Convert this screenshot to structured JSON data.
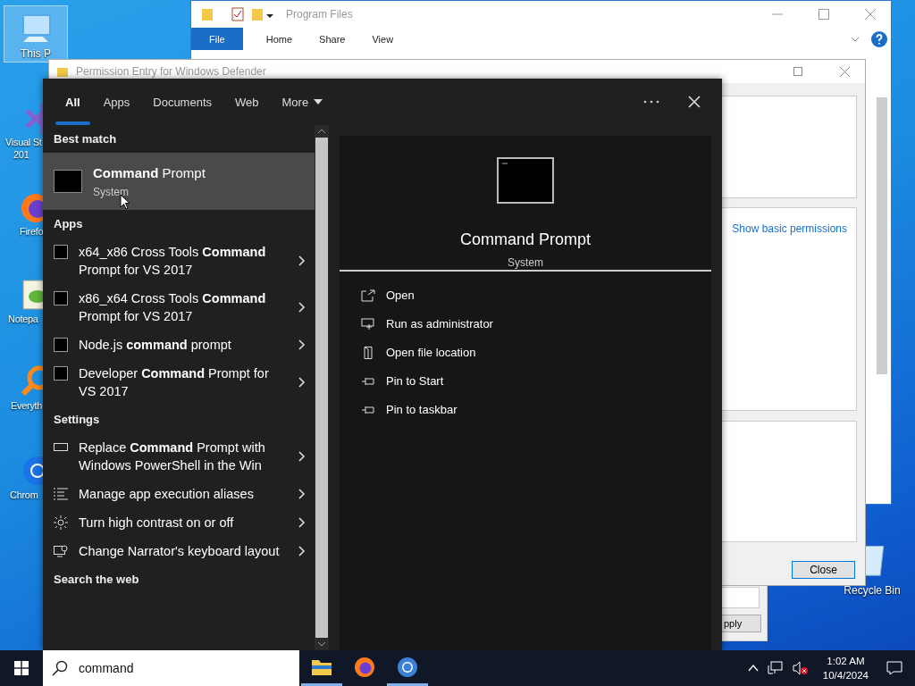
{
  "desktop_icons": [
    {
      "kind": "pc",
      "lines": [
        "This P"
      ],
      "selected": true
    },
    {
      "kind": "vs",
      "lines": [
        "Visual St",
        "201"
      ],
      "selected": false
    },
    {
      "kind": "firefox",
      "lines": [
        "Firefo"
      ],
      "selected": false
    },
    {
      "kind": "notepad",
      "lines": [
        "Notepa"
      ],
      "selected": false
    },
    {
      "kind": "everything",
      "lines": [
        "Everyth"
      ],
      "selected": false
    },
    {
      "kind": "chrome",
      "lines": [
        "Chrom"
      ],
      "selected": false
    }
  ],
  "recycle_bin": {
    "label": "Recycle Bin"
  },
  "explorer_window": {
    "title": "Program Files",
    "ribbon_tabs": [
      {
        "label": "File",
        "selected": true
      },
      {
        "label": "Home",
        "selected": false
      },
      {
        "label": "Share",
        "selected": false
      },
      {
        "label": "View",
        "selected": false
      }
    ]
  },
  "properties_window": {
    "button": "pply"
  },
  "permission_dialog": {
    "title": "Permission Entry for Windows Defender",
    "link": "Show basic permissions",
    "close_button": "Close"
  },
  "search_panel": {
    "tabs": [
      {
        "label": "All",
        "selected": true
      },
      {
        "label": "Apps",
        "selected": false
      },
      {
        "label": "Documents",
        "selected": false
      },
      {
        "label": "Web",
        "selected": false
      }
    ],
    "more": "More",
    "best_match_heading": "Best match",
    "best_match": {
      "title": "**Command** Prompt",
      "subtitle": "System",
      "selected": true
    },
    "sections": [
      {
        "heading": "Apps",
        "items": [
          {
            "kind": "console",
            "text": "x64_x86 Cross Tools **Command** Prompt for VS 2017"
          },
          {
            "kind": "console",
            "text": "x86_x64 Cross Tools **Command** Prompt for VS 2017"
          },
          {
            "kind": "console",
            "text": "Node.js **command** prompt"
          },
          {
            "kind": "console",
            "text": "Developer **Command** Prompt for VS 2017"
          }
        ]
      },
      {
        "heading": "Settings",
        "items": [
          {
            "kind": "display",
            "text": "Replace **Command** Prompt with Windows PowerShell in the Win"
          },
          {
            "kind": "list",
            "text": "Manage app execution aliases"
          },
          {
            "kind": "sun",
            "text": "Turn high contrast on or off"
          },
          {
            "kind": "narrator",
            "text": "Change Narrator's keyboard layout"
          }
        ]
      }
    ],
    "web_heading": "Search the web",
    "preview": {
      "title": "Command Prompt",
      "subtitle": "System",
      "actions": [
        {
          "kind": "open",
          "label": "Open"
        },
        {
          "kind": "shield",
          "label": "Run as administrator"
        },
        {
          "kind": "file",
          "label": "Open file location"
        },
        {
          "kind": "pin",
          "label": "Pin to Start"
        },
        {
          "kind": "pin",
          "label": "Pin to taskbar"
        }
      ]
    }
  },
  "taskbar": {
    "search_value": "command",
    "apps": [
      {
        "kind": "folder",
        "running": true
      },
      {
        "kind": "firefox",
        "running": false
      },
      {
        "kind": "chrome",
        "running": true
      }
    ],
    "time": "1:02 AM",
    "date": "10/4/2024"
  }
}
